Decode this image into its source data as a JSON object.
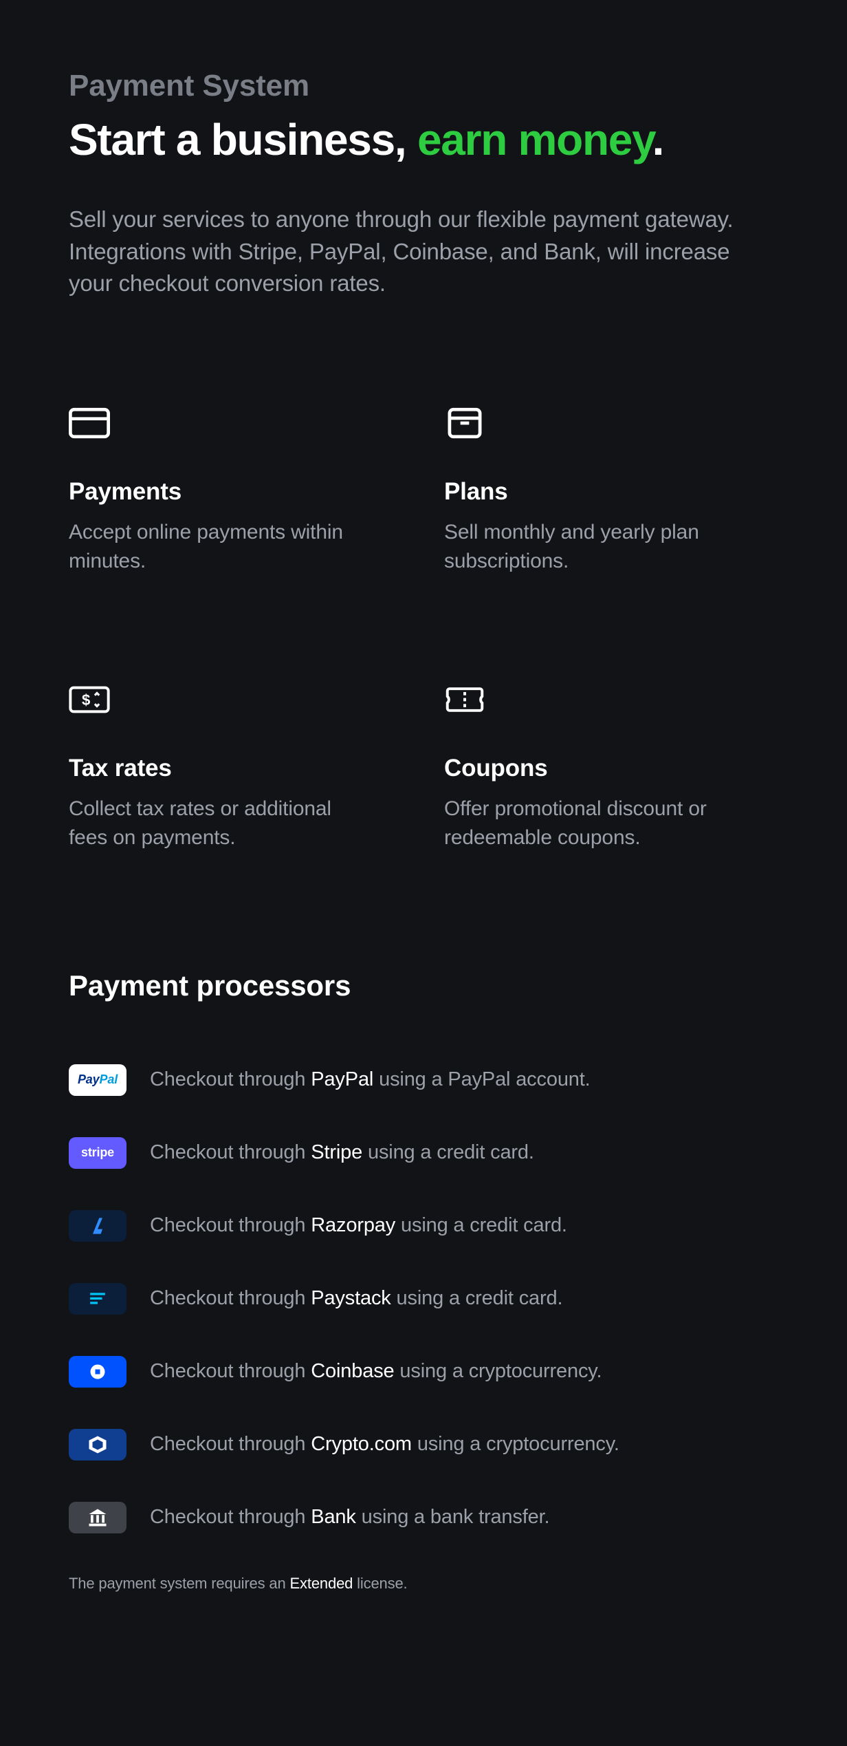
{
  "eyebrow": "Payment System",
  "headline_pre": "Start a business, ",
  "headline_accent": "earn money",
  "headline_post": ".",
  "lead": "Sell your services to anyone through our flexible payment gateway. Integrations with Stripe, PayPal, Coinbase, and Bank, will increase your checkout conversion rates.",
  "features": [
    {
      "title": "Payments",
      "desc": "Accept online payments within minutes."
    },
    {
      "title": "Plans",
      "desc": "Sell monthly and yearly plan subscriptions."
    },
    {
      "title": "Tax rates",
      "desc": "Collect tax rates or additional fees on payments."
    },
    {
      "title": "Coupons",
      "desc": "Offer promotional discount or redeemable coupons."
    }
  ],
  "processors_title": "Payment processors",
  "processors": [
    {
      "name": "PayPal",
      "pre": "Checkout through ",
      "post": " using a PayPal account."
    },
    {
      "name": "Stripe",
      "pre": "Checkout through ",
      "post": " using a credit card."
    },
    {
      "name": "Razorpay",
      "pre": "Checkout through ",
      "post": " using a credit card."
    },
    {
      "name": "Paystack",
      "pre": "Checkout through ",
      "post": " using a credit card."
    },
    {
      "name": "Coinbase",
      "pre": "Checkout through ",
      "post": " using a cryptocurrency."
    },
    {
      "name": "Crypto.com",
      "pre": "Checkout through ",
      "post": " using a cryptocurrency."
    },
    {
      "name": "Bank",
      "pre": "Checkout through ",
      "post": " using a bank transfer."
    }
  ],
  "footnote_pre": "The payment system requires an ",
  "footnote_strong": "Extended",
  "footnote_post": " license."
}
